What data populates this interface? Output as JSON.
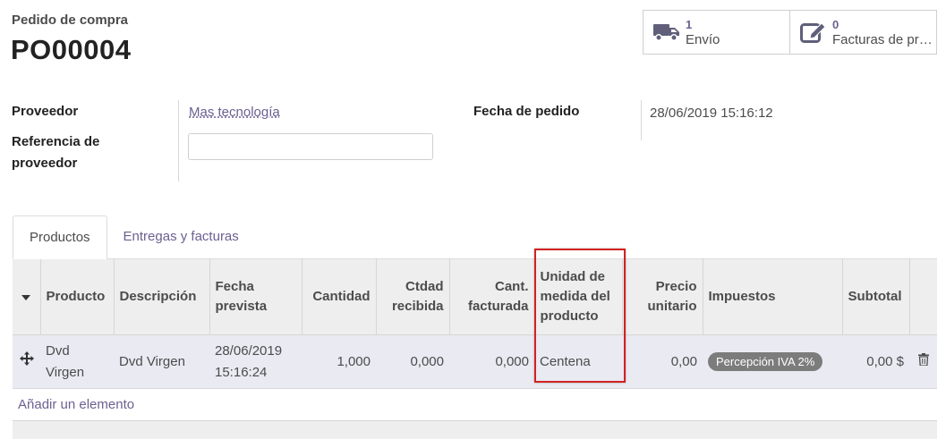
{
  "header": {
    "subtitle": "Pedido de compra",
    "name": "PO00004"
  },
  "smart_buttons": [
    {
      "count": "1",
      "label": "Envío",
      "icon": "truck-icon"
    },
    {
      "count": "0",
      "label": "Facturas de proveedor",
      "icon": "edit-icon"
    }
  ],
  "form": {
    "partner_label": "Proveedor",
    "partner_value": "Mas tecnología",
    "partner_ref_label_1": "Referencia de",
    "partner_ref_label_2": "proveedor",
    "partner_ref_value": "",
    "date_order_label": "Fecha de pedido",
    "date_order_value": "28/06/2019 15:16:12"
  },
  "tabs": [
    {
      "label": "Productos",
      "active": true
    },
    {
      "label": "Entregas y facturas",
      "active": false
    }
  ],
  "grid": {
    "headers": {
      "product": "Producto",
      "description": "Descripción",
      "date_planned_1": "Fecha",
      "date_planned_2": "prevista",
      "qty": "Cantidad",
      "qty_received_1": "Ctdad",
      "qty_received_2": "recibida",
      "qty_invoiced_1": "Cant.",
      "qty_invoiced_2": "facturada",
      "uom_1": "Unidad de",
      "uom_2": "medida del",
      "uom_3": "producto",
      "price_1": "Precio",
      "price_2": "unitario",
      "taxes": "Impuestos",
      "subtotal": "Subtotal"
    },
    "rows": [
      {
        "product_1": "Dvd",
        "product_2": "Virgen",
        "description": "Dvd Virgen",
        "date_planned_1": "28/06/2019",
        "date_planned_2": "15:16:24",
        "qty": "1,000",
        "qty_received": "0,000",
        "qty_invoiced": "0,000",
        "uom": "Centena",
        "price_unit": "0,00",
        "tax": "Percepción IVA 2%",
        "subtotal": "0,00 $"
      }
    ],
    "add_line": "Añadir un elemento"
  },
  "colors": {
    "accent": "#6c6091",
    "highlight_box": "#d32222",
    "row_bg": "#e9eaf2",
    "header_bg": "#eeeeee"
  }
}
